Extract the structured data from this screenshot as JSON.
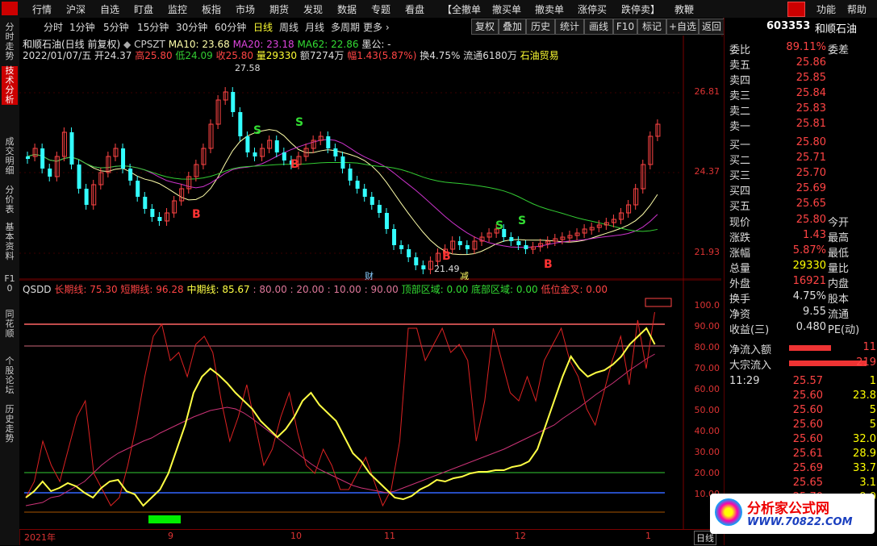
{
  "menubar": {
    "items": [
      "行情",
      "沪深",
      "自选",
      "盯盘",
      "监控",
      "板指",
      "市场",
      "期货",
      "发现",
      "数据",
      "专题",
      "看盘",
      "【全撤单",
      "撤买单",
      "撤卖单",
      "涨停买",
      "跌停卖】",
      "教鞭"
    ],
    "right_items": [
      "功能",
      "帮助"
    ]
  },
  "toolbar": {
    "periods": [
      "分时",
      "1分钟",
      "5分钟",
      "15分钟",
      "30分钟",
      "60分钟",
      "日线",
      "周线",
      "月线",
      "多周期",
      "更多 ›"
    ],
    "active_period": "日线",
    "buttons": [
      "复权",
      "叠加",
      "历史",
      "统计",
      "画线",
      "F10",
      "标记",
      "+自选",
      "返回"
    ]
  },
  "left_tabs": [
    "分时走势",
    "技术分析",
    "成交明细",
    "分价表",
    "基本资料",
    "F10",
    "同花顺",
    "个股论坛",
    "历史走势"
  ],
  "main_chart": {
    "header_line1": {
      "name": "和顺石油(日线 前复权)",
      "indicator": "CPSZT",
      "ma10": "MA10: 23.68",
      "ma20": "MA20: 23.18",
      "ma62": "MA62: 22.86",
      "extra": "墨公: -"
    },
    "header_line2": {
      "date": "2022/01/07/五",
      "open": "开24.37",
      "high": "高25.80",
      "low": "低24.09",
      "close": "收25.80",
      "volume": "量29330",
      "amount": "额7274万",
      "change": "幅1.43(5.87%)",
      "turnover": "换4.75%",
      "float": "流通6180万",
      "sector": "石油贸易"
    },
    "y_labels": [
      "26.81",
      "24.37",
      "21.93"
    ],
    "peak_label": "27.58",
    "trough_label": "21.49",
    "markers": [
      {
        "text": "B",
        "color": "#ff3333"
      },
      {
        "text": "S",
        "color": "#33dd33"
      },
      {
        "text": "S",
        "color": "#33dd33"
      },
      {
        "text": "B",
        "color": "#ff3333"
      },
      {
        "text": "B",
        "color": "#ff3333"
      },
      {
        "text": "S",
        "color": "#33dd33"
      },
      {
        "text": "S",
        "color": "#33dd33"
      },
      {
        "text": "B",
        "color": "#ff3333"
      }
    ],
    "tags": [
      "财",
      "减"
    ]
  },
  "sub_chart": {
    "title": "QSDD",
    "long": "长期线: 75.30",
    "short": "短期线: 96.28",
    "mid": "中期线: 85.67",
    "levels": ": 80.00 : 20.00 : 10.00 : 90.00",
    "top_zone": "顶部区域: 0.00",
    "bottom_zone": "底部区域: 0.00",
    "golden_cross": "低位金叉: 0.00",
    "y_labels": [
      "100.0",
      "90.00",
      "80.00",
      "70.00",
      "60.00",
      "50.00",
      "40.00",
      "30.00",
      "20.00",
      "10.00"
    ],
    "x_labels": [
      "2021年",
      "9",
      "10",
      "11",
      "12",
      "1"
    ],
    "corner": "日线"
  },
  "chart_data": {
    "type": "candlestick",
    "series": [
      {
        "name": "MA10",
        "color": "#ffffaa"
      },
      {
        "name": "MA20",
        "color": "#cc33cc"
      },
      {
        "name": "MA62",
        "color": "#33cc33"
      }
    ],
    "price_range": [
      21.93,
      27.58
    ]
  },
  "quote": {
    "code": "603353",
    "name": "和顺石油",
    "weibi_label": "委比",
    "weibi_value": "89.11%",
    "weicha_label": "委差",
    "asks": [
      {
        "label": "卖五",
        "price": "25.86"
      },
      {
        "label": "卖四",
        "price": "25.85"
      },
      {
        "label": "卖三",
        "price": "25.84"
      },
      {
        "label": "卖二",
        "price": "25.83"
      },
      {
        "label": "卖一",
        "price": "25.81"
      }
    ],
    "bids": [
      {
        "label": "买一",
        "price": "25.80"
      },
      {
        "label": "买二",
        "price": "25.71"
      },
      {
        "label": "买三",
        "price": "25.70"
      },
      {
        "label": "买四",
        "price": "25.69"
      },
      {
        "label": "买五",
        "price": "25.65"
      }
    ],
    "stats": [
      {
        "label": "现价",
        "value": "25.80",
        "label2": "今开"
      },
      {
        "label": "涨跌",
        "value": "1.43",
        "label2": "最高"
      },
      {
        "label": "涨幅",
        "value": "5.87%",
        "label2": "最低"
      },
      {
        "label": "总量",
        "value": "29330",
        "label2": "量比"
      },
      {
        "label": "外盘",
        "value": "16921",
        "label2": "内盘"
      },
      {
        "label": "换手",
        "value": "4.75%",
        "label2": "股本"
      },
      {
        "label": "净资",
        "value": "9.55",
        "label2": "流通"
      },
      {
        "label": "收益(三)",
        "value": "0.480",
        "label2": "PE(动)"
      }
    ],
    "flow": [
      {
        "label": "净流入额",
        "value": "11"
      },
      {
        "label": "大宗流入",
        "value": "219"
      }
    ],
    "ticks": [
      {
        "time": "11:29",
        "price": "25.57",
        "vol": "1"
      },
      {
        "time": "",
        "price": "25.60",
        "vol": "23.8"
      },
      {
        "time": "",
        "price": "25.60",
        "vol": "5"
      },
      {
        "time": "",
        "price": "25.60",
        "vol": "5"
      },
      {
        "time": "",
        "price": "25.60",
        "vol": "32.0"
      },
      {
        "time": "",
        "price": "25.61",
        "vol": "28.9"
      },
      {
        "time": "",
        "price": "25.69",
        "vol": "33.7"
      },
      {
        "time": "",
        "price": "25.65",
        "vol": "3.1"
      },
      {
        "time": "",
        "price": "25.70",
        "vol": "9.0"
      }
    ]
  },
  "watermark": {
    "brand": "分析家公式网",
    "url": "WWW.70822.COM"
  }
}
